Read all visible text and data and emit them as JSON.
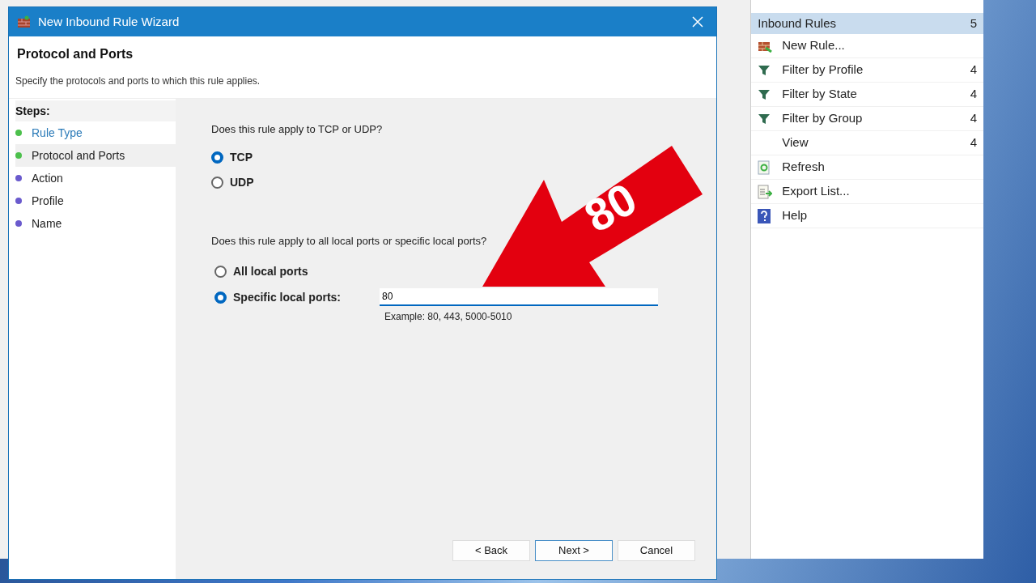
{
  "wizard": {
    "title": "New Inbound Rule Wizard",
    "heading": "Protocol and Ports",
    "description": "Specify the protocols and ports to which this rule applies.",
    "steps_label": "Steps:",
    "steps": [
      {
        "label": "Rule Type",
        "color": "#4cc04c",
        "selected": false,
        "kind": "link"
      },
      {
        "label": "Protocol and Ports",
        "color": "#4cc04c",
        "selected": true,
        "kind": "step"
      },
      {
        "label": "Action",
        "color": "#6a5acd",
        "selected": false,
        "kind": "step"
      },
      {
        "label": "Profile",
        "color": "#6a5acd",
        "selected": false,
        "kind": "step"
      },
      {
        "label": "Name",
        "color": "#6a5acd",
        "selected": false,
        "kind": "step"
      }
    ],
    "protocol_question": "Does this rule apply to TCP or UDP?",
    "protocols": [
      {
        "label": "TCP",
        "selected": true
      },
      {
        "label": "UDP",
        "selected": false
      }
    ],
    "ports_question": "Does this rule apply to all local ports or specific local ports?",
    "port_options": [
      {
        "label": "All local ports",
        "selected": false
      },
      {
        "label": "Specific local ports:",
        "selected": true
      }
    ],
    "ports_value": "80",
    "ports_example": "Example: 80, 443, 5000-5010",
    "buttons": [
      "< Back",
      "Next >",
      "Cancel"
    ]
  },
  "annotation": {
    "text": "80"
  },
  "actions": {
    "header": {
      "label": "Inbound Rules",
      "count": "5"
    },
    "items": [
      {
        "label": "New Rule...",
        "kind": "new"
      },
      {
        "label": "Filter by Profile",
        "count": "4",
        "kind": "filter"
      },
      {
        "label": "Filter by State",
        "count": "4",
        "kind": "filter"
      },
      {
        "label": "Filter by Group",
        "count": "4",
        "kind": "filter"
      },
      {
        "label": "View",
        "count": "4",
        "kind": "plain"
      },
      {
        "label": "Refresh",
        "kind": "refresh"
      },
      {
        "label": "Export List...",
        "kind": "export"
      },
      {
        "label": "Help",
        "kind": "help"
      }
    ]
  }
}
